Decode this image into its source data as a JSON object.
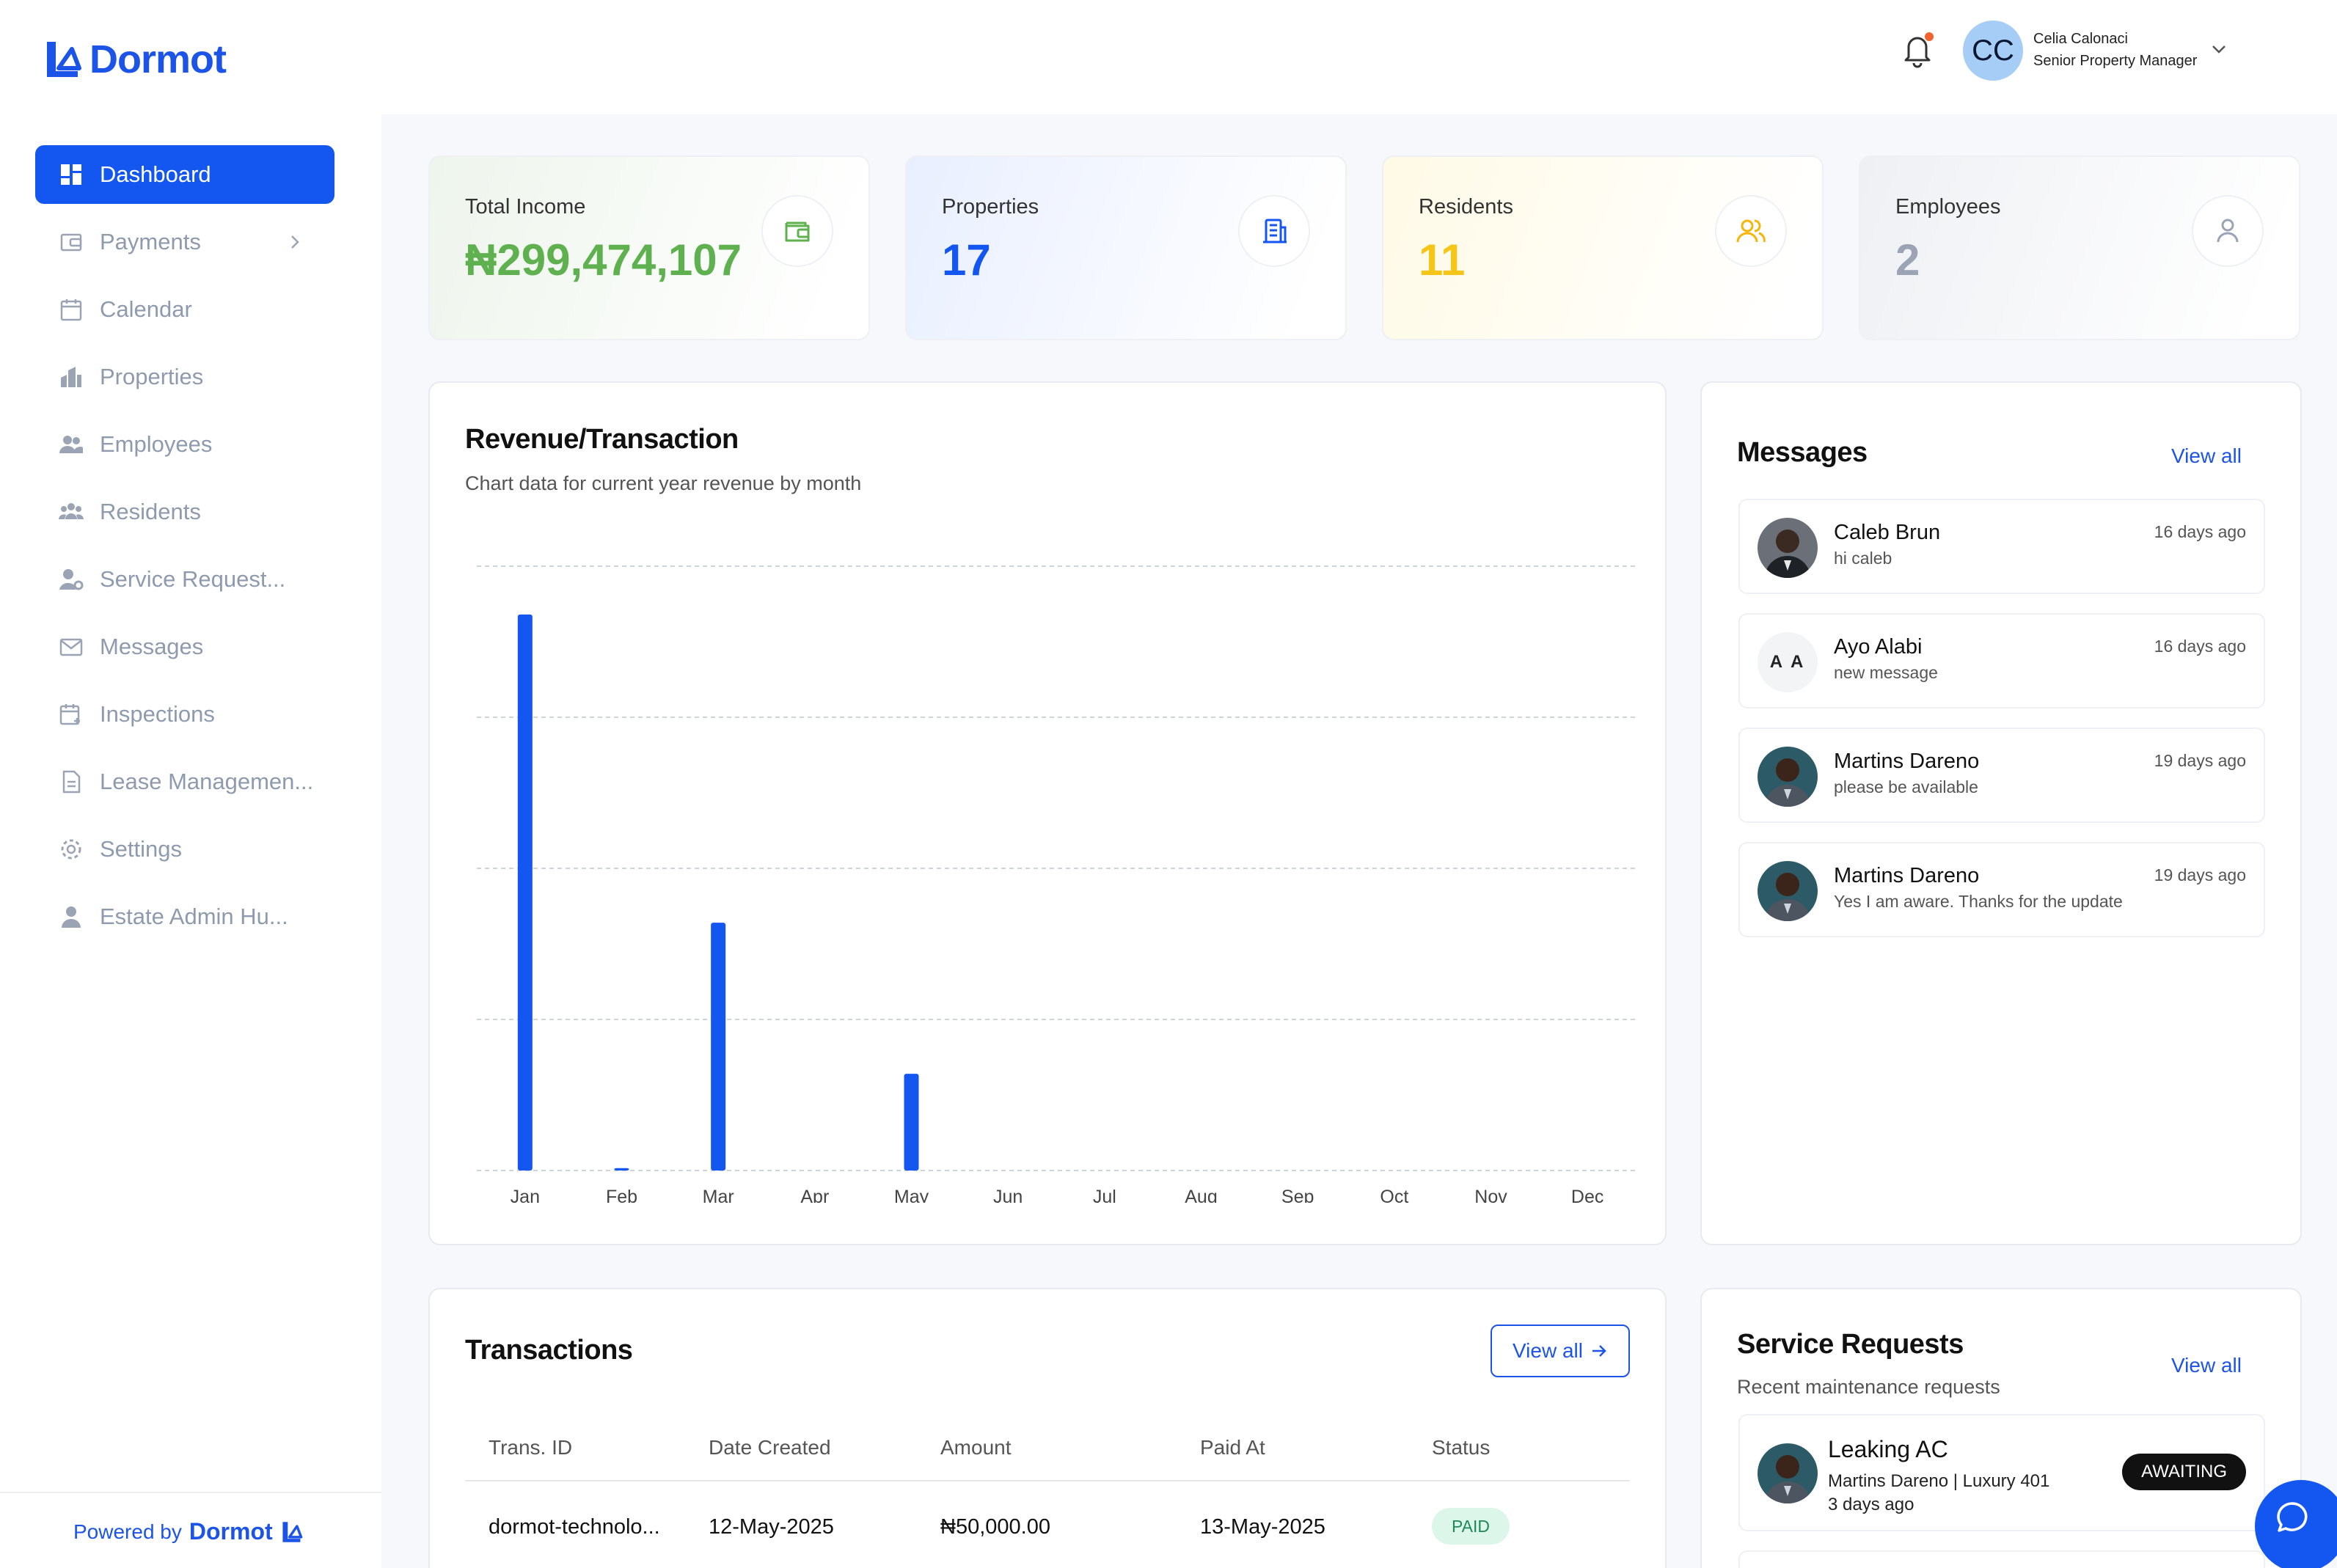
{
  "app": {
    "brand": "Dormot"
  },
  "header": {
    "user_initials": "CC",
    "user_name": "Celia Calonaci",
    "user_role": "Senior Property Manager"
  },
  "sidebar": {
    "items": [
      {
        "label": "Dashboard",
        "icon": "dashboard-icon",
        "active": true
      },
      {
        "label": "Payments",
        "icon": "wallet-icon",
        "has_submenu": true
      },
      {
        "label": "Calendar",
        "icon": "calendar-icon"
      },
      {
        "label": "Properties",
        "icon": "building-icon"
      },
      {
        "label": "Employees",
        "icon": "employees-icon"
      },
      {
        "label": "Residents",
        "icon": "residents-icon"
      },
      {
        "label": "Service Request...",
        "icon": "service-request-icon"
      },
      {
        "label": "Messages",
        "icon": "mail-icon"
      },
      {
        "label": "Inspections",
        "icon": "inspection-calendar-icon"
      },
      {
        "label": "Lease Managemen...",
        "icon": "document-icon"
      },
      {
        "label": "Settings",
        "icon": "gear-icon"
      },
      {
        "label": "Estate Admin Hu...",
        "icon": "admin-user-icon"
      }
    ],
    "powered_by_label": "Powered by",
    "powered_by_brand": "Dormot"
  },
  "stats": [
    {
      "label": "Total Income",
      "value": "₦299,474,107",
      "color": "#5fb04f",
      "icon": "wallet-icon"
    },
    {
      "label": "Properties",
      "value": "17",
      "color": "#1456f0",
      "icon": "building-icon"
    },
    {
      "label": "Residents",
      "value": "11",
      "color": "#f5c518",
      "icon": "users-icon"
    },
    {
      "label": "Employees",
      "value": "2",
      "color": "#9aa4b5",
      "icon": "user-icon"
    }
  ],
  "revenue": {
    "title": "Revenue/Transaction",
    "subtitle": "Chart data for current year revenue by month"
  },
  "chart_data": {
    "type": "bar",
    "categories": [
      "Jan",
      "Feb",
      "Mar",
      "Apr",
      "May",
      "Jun",
      "Jul",
      "Aug",
      "Sep",
      "Oct",
      "Nov",
      "Dec"
    ],
    "values": [
      1.84,
      0.008,
      0.82,
      0,
      0.32,
      0,
      0,
      0,
      0,
      0,
      0,
      0
    ],
    "ylim": [
      0,
      2
    ],
    "grid": true,
    "bar_color": "#1456f0"
  },
  "messages": {
    "title": "Messages",
    "view_all": "View all",
    "items": [
      {
        "name": "Caleb Brun",
        "text": "hi caleb",
        "time": "16 days ago",
        "avatar": "photo"
      },
      {
        "name": "Ayo Alabi",
        "text": "new message",
        "time": "16 days ago",
        "avatar": "initials",
        "initials": "A A"
      },
      {
        "name": "Martins Dareno",
        "text": "please be available",
        "time": "19 days ago",
        "avatar": "photo"
      },
      {
        "name": "Martins Dareno",
        "text": "Yes I am aware. Thanks for the update",
        "time": "19 days ago",
        "avatar": "photo"
      }
    ]
  },
  "transactions": {
    "title": "Transactions",
    "view_all": "View all",
    "columns": [
      "Trans. ID",
      "Date Created",
      "Amount",
      "Paid At",
      "Status"
    ],
    "rows": [
      {
        "id": "dormot-technolo...",
        "date_created": "12-May-2025",
        "amount": "₦50,000.00",
        "paid_at": "13-May-2025",
        "status": "PAID"
      }
    ]
  },
  "service_requests": {
    "title": "Service Requests",
    "subtitle": "Recent maintenance requests",
    "view_all": "View all",
    "items": [
      {
        "title": "Leaking AC",
        "meta": "Martins Dareno | Luxury 401",
        "time": "3 days ago",
        "status": "AWAITING"
      }
    ]
  }
}
